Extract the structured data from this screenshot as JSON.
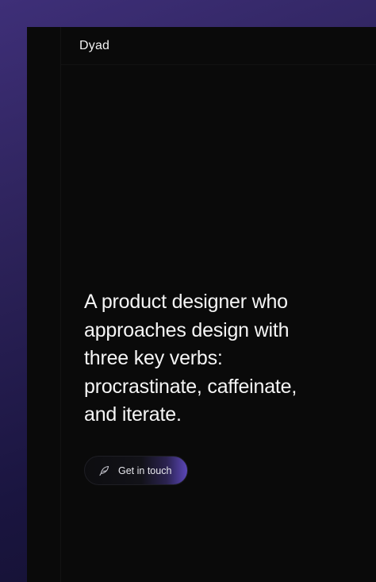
{
  "header": {
    "brand": "Dyad"
  },
  "hero": {
    "headline_lines": [
      "A product designer who",
      "approaches design with",
      "three key verbs:",
      "procrastinate, caffeinate,",
      "and iterate."
    ],
    "cta_label": "Get in touch",
    "cta_icon": "feather-icon"
  },
  "colors": {
    "outer_background": "#2c2259",
    "window_background": "#0a0a0a",
    "text": "#f5f5f5",
    "accent": "#5b47b8"
  }
}
